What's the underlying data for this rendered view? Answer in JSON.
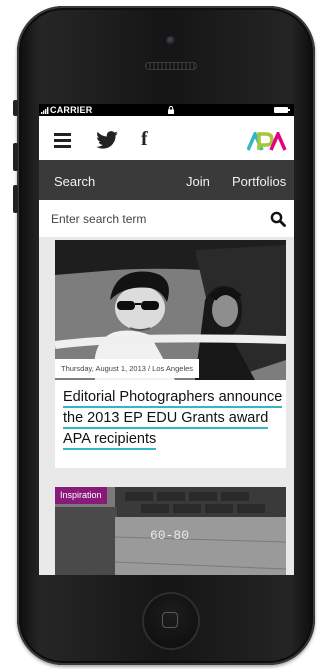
{
  "status_bar": {
    "carrier": "CARRIER"
  },
  "topbar": {
    "icons": [
      "menu-icon",
      "twitter-icon",
      "facebook-icon"
    ],
    "logo_text": "APA",
    "facebook_glyph": "f"
  },
  "nav": {
    "search_label": "Search",
    "join_label": "Join",
    "portfolios_label": "Portfolios"
  },
  "search": {
    "placeholder": "Enter search term"
  },
  "articles": [
    {
      "date": "Thursday, August 1, 2013 / Los Angeles",
      "headline": "Editorial Photographers announce the 2013 EP EDU Grants award APA recipients"
    },
    {
      "category": "Inspiration",
      "photo_text": "60-80"
    }
  ],
  "colors": {
    "nav_background": "#3a3a3a",
    "headline_underline": "#35b6c7",
    "tag_background": "#8a1a7a",
    "logo_colors": [
      "#35b6c7",
      "#a4c639",
      "#e6007e"
    ]
  }
}
